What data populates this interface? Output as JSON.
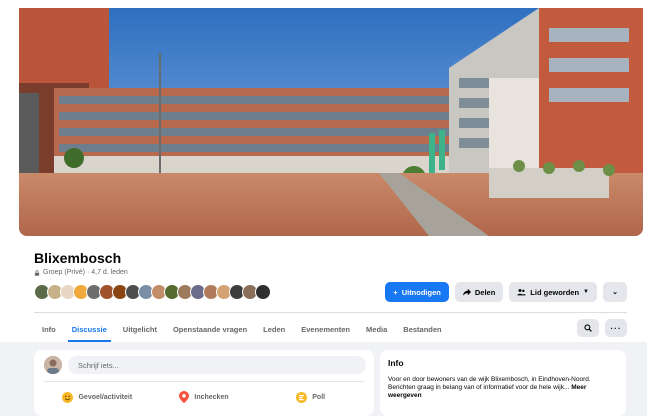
{
  "group": {
    "name": "Blixembosch",
    "meta": "Groep (Privé) · 4,7 d. leden"
  },
  "member_avatar_colors": [
    "#5b6b4a",
    "#c7b18a",
    "#e8d6c2",
    "#f2a93b",
    "#6d6d6d",
    "#a0522d",
    "#8b4513",
    "#4e4e4e",
    "#7a8fa6",
    "#c48d6a",
    "#556b2f",
    "#9c7a5b",
    "#6b6b8a",
    "#b07b5a",
    "#d4a373",
    "#3d3d3d",
    "#8a6f5a",
    "#2f2f2f"
  ],
  "actions": {
    "invite": "Uitnodigen",
    "share": "Delen",
    "joined": "Lid geworden"
  },
  "tabs": [
    {
      "label": "Info",
      "active": false
    },
    {
      "label": "Discussie",
      "active": true
    },
    {
      "label": "Uitgelicht",
      "active": false
    },
    {
      "label": "Openstaande vragen",
      "active": false
    },
    {
      "label": "Leden",
      "active": false
    },
    {
      "label": "Evenementen",
      "active": false
    },
    {
      "label": "Media",
      "active": false
    },
    {
      "label": "Bestanden",
      "active": false
    }
  ],
  "composer": {
    "placeholder": "Schrijf iets...",
    "options": [
      {
        "label": "Gevoel/activiteit",
        "icon": "smiley-icon",
        "color": "#f7b928"
      },
      {
        "label": "Inchecken",
        "icon": "location-pin-icon",
        "color": "#f5533d"
      },
      {
        "label": "Poll",
        "icon": "poll-icon",
        "color": "#f7b928"
      }
    ]
  },
  "info": {
    "title": "Info",
    "line1": "Voor en door bewoners van de wijk Blixembosch, in Eindhoven-Noord.",
    "line2": "Berichten graag in belang van of informatief voor de hele wijk...",
    "more": "Meer weergeven"
  },
  "colors": {
    "accent": "#1877f2",
    "secondary_button": "#e4e6eb",
    "feed_background": "#f0f2f5"
  }
}
